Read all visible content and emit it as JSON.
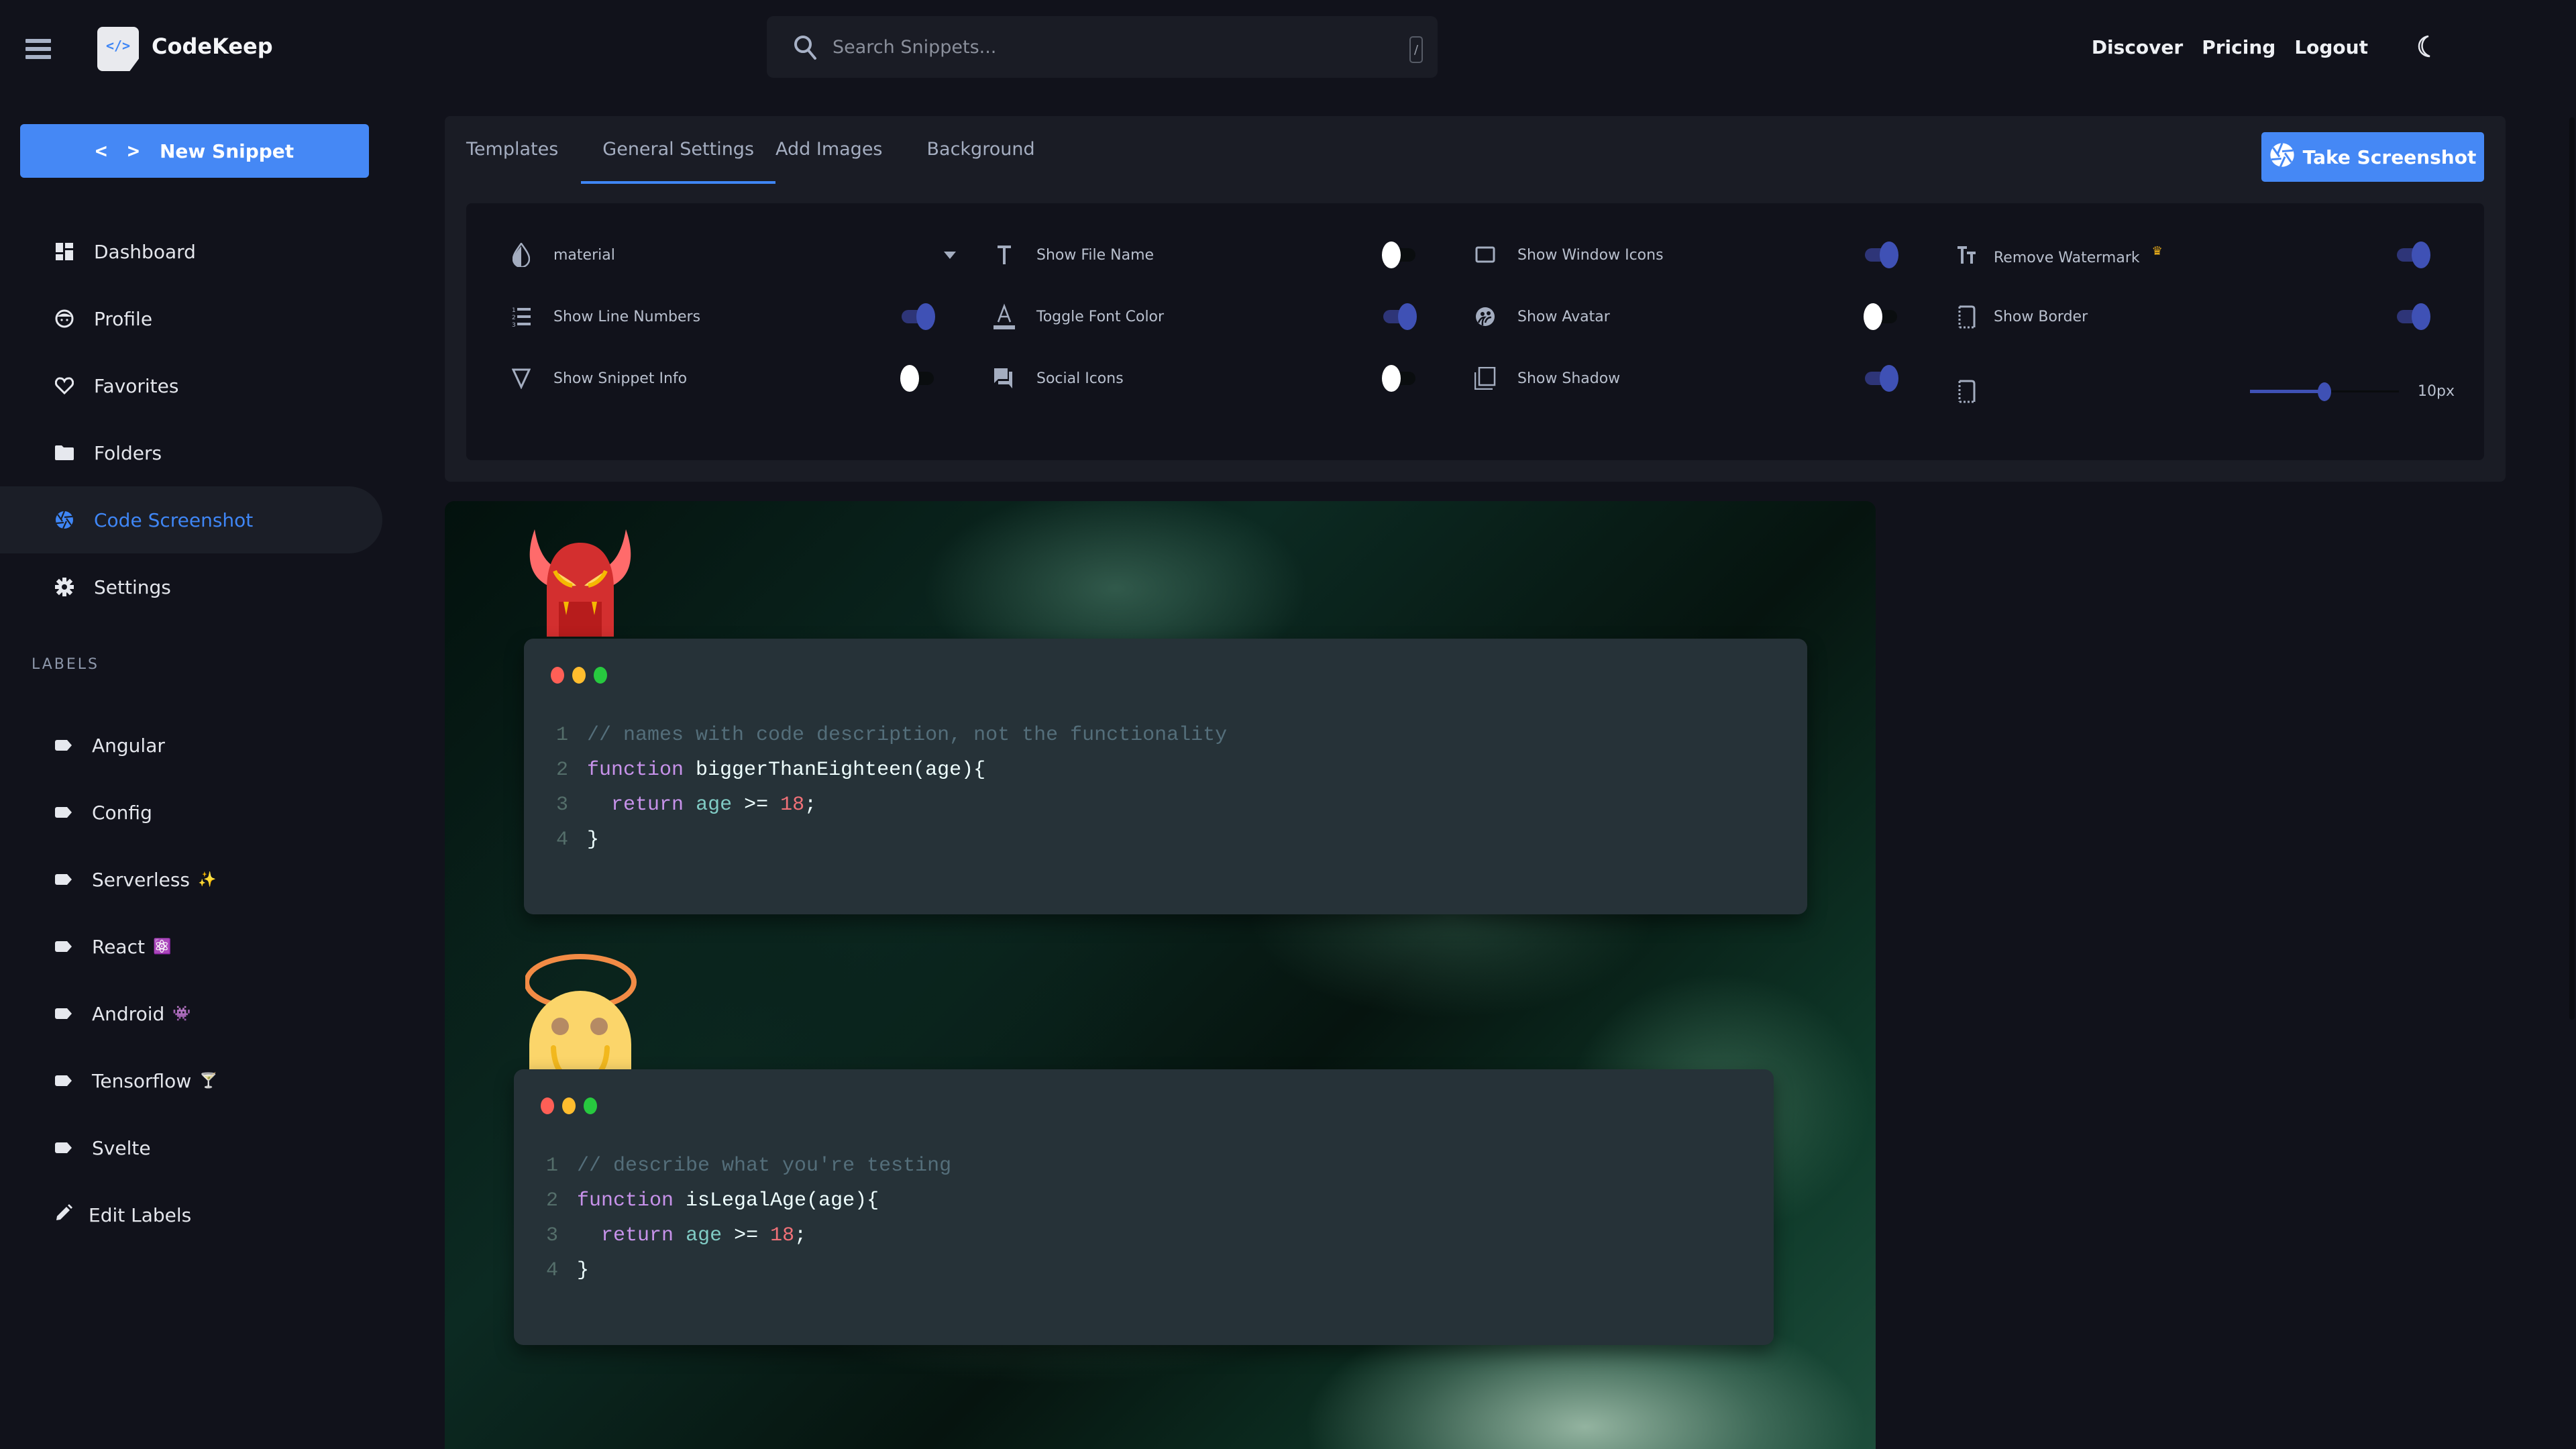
{
  "app": {
    "name": "CodeKeep",
    "logo_glyph": "</>"
  },
  "header": {
    "search": {
      "placeholder": "Search Snippets...",
      "value": "",
      "shortcut": "/"
    },
    "nav": [
      "Discover",
      "Pricing",
      "Logout"
    ],
    "theme_icon": "moon-icon"
  },
  "sidebar": {
    "new_snippet_label": "New Snippet",
    "new_snippet_icon": "< >",
    "items": [
      {
        "label": "Dashboard",
        "icon": "dashboard-icon",
        "active": false
      },
      {
        "label": "Profile",
        "icon": "profile-icon",
        "active": false
      },
      {
        "label": "Favorites",
        "icon": "heart-icon",
        "active": false
      },
      {
        "label": "Folders",
        "icon": "folder-icon",
        "active": false
      },
      {
        "label": "Code Screenshot",
        "icon": "camera-shutter-icon",
        "active": true
      },
      {
        "label": "Settings",
        "icon": "gear-icon",
        "active": false
      }
    ],
    "labels_heading": "LABELS",
    "labels": [
      {
        "label": "Angular",
        "emoji": ""
      },
      {
        "label": "Config",
        "emoji": ""
      },
      {
        "label": "Serverless",
        "emoji": "✨"
      },
      {
        "label": "React",
        "emoji": "⚛️"
      },
      {
        "label": "Android",
        "emoji": "👾"
      },
      {
        "label": "Tensorflow",
        "emoji": "🍸"
      },
      {
        "label": "Svelte",
        "emoji": ""
      }
    ],
    "edit_labels": "Edit Labels"
  },
  "panel": {
    "tabs": [
      {
        "label": "Templates",
        "active": false
      },
      {
        "label": "General Settings",
        "active": true
      },
      {
        "label": "Add Images",
        "active": false
      },
      {
        "label": "Background",
        "active": false
      }
    ],
    "take_screenshot_label": "Take Screenshot",
    "theme_select": {
      "value": "material"
    },
    "options": [
      {
        "id": "line_numbers",
        "label": "Show Line Numbers",
        "on": true
      },
      {
        "id": "snippet_info",
        "label": "Show Snippet Info",
        "on": false
      },
      {
        "id": "file_name",
        "label": "Show File Name",
        "on": false
      },
      {
        "id": "font_color",
        "label": "Toggle Font Color",
        "on": true
      },
      {
        "id": "social_icons",
        "label": "Social Icons",
        "on": false
      },
      {
        "id": "window_icons",
        "label": "Show Window Icons",
        "on": true
      },
      {
        "id": "avatar",
        "label": "Show Avatar",
        "on": false
      },
      {
        "id": "shadow",
        "label": "Show Shadow",
        "on": true
      },
      {
        "id": "watermark",
        "label": "Remove Watermark",
        "on": true,
        "premium": "♛"
      },
      {
        "id": "border",
        "label": "Show Border",
        "on": true
      }
    ],
    "border_radius": {
      "value": 10,
      "unit": "px",
      "display": "10px",
      "fraction": 0.5
    }
  },
  "canvas": {
    "window_dot_colors": [
      "#ff5f56",
      "#ffbd2e",
      "#27c93f"
    ],
    "snippets": [
      {
        "avatar": "devil",
        "lines": [
          [
            [
              "comment",
              "// names with code description, not the functionality"
            ]
          ],
          [
            [
              "keyword",
              "function"
            ],
            [
              "fn",
              " biggerThanEighteen"
            ],
            [
              "punct",
              "(age){"
            ]
          ],
          [
            [
              "punct",
              "  "
            ],
            [
              "keyword",
              "return"
            ],
            [
              "punct",
              " "
            ],
            [
              "var",
              "age"
            ],
            [
              "op",
              " >= "
            ],
            [
              "num",
              "18"
            ],
            [
              "punct",
              ";"
            ]
          ],
          [
            [
              "punct",
              "}"
            ]
          ]
        ]
      },
      {
        "avatar": "angel",
        "lines": [
          [
            [
              "comment",
              "// describe what you're testing"
            ]
          ],
          [
            [
              "keyword",
              "function"
            ],
            [
              "fn",
              " isLegalAge"
            ],
            [
              "punct",
              "(age){"
            ]
          ],
          [
            [
              "punct",
              "  "
            ],
            [
              "keyword",
              "return"
            ],
            [
              "punct",
              " "
            ],
            [
              "var",
              "age"
            ],
            [
              "op",
              " >= "
            ],
            [
              "num",
              "18"
            ],
            [
              "punct",
              ";"
            ]
          ],
          [
            [
              "punct",
              "}"
            ]
          ]
        ]
      }
    ]
  },
  "colors": {
    "accent": "#4588f5",
    "toggle_on": "#3f51b5",
    "background": "#11121b",
    "panel": "#1a1c25",
    "code_bg": "#263238"
  }
}
